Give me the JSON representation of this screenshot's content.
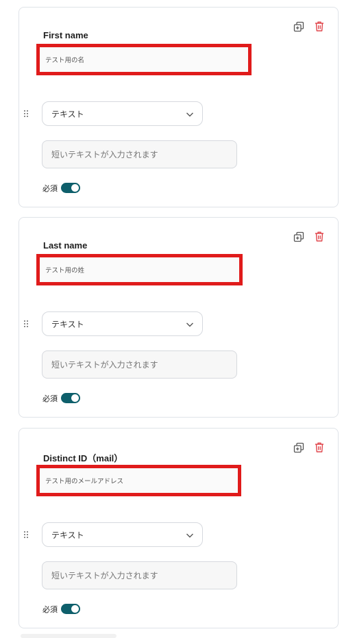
{
  "colors": {
    "accent_teal": "#0e5f6b",
    "highlight_red": "#e01b1b",
    "trash_red": "#e0454b"
  },
  "icons": {
    "copy": "copy-icon",
    "trash": "trash-icon",
    "drag": "drag-handle-icon",
    "chevron": "chevron-down-icon"
  },
  "fields": [
    {
      "title": "First name",
      "sample_value": "テスト用の名",
      "type_value": "テキスト",
      "input_placeholder": "短いテキストが入力されます",
      "required_label": "必須",
      "required": true
    },
    {
      "title": "Last name",
      "sample_value": "テスト用の姓",
      "type_value": "テキスト",
      "input_placeholder": "短いテキストが入力されます",
      "required_label": "必須",
      "required": true
    },
    {
      "title": "Distinct ID（mail）",
      "sample_value": "テスト用のメールアドレス",
      "type_value": "テキスト",
      "input_placeholder": "短いテキストが入力されます",
      "required_label": "必須",
      "required": true
    }
  ]
}
